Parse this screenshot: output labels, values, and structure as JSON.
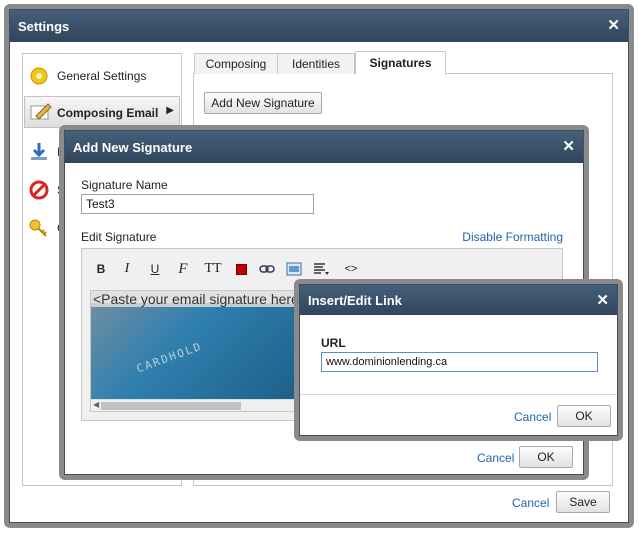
{
  "settings": {
    "title": "Settings",
    "sidebar": {
      "items": [
        {
          "label": "General Settings",
          "icon": "gear-icon"
        },
        {
          "label": "Composing Email",
          "icon": "compose-icon"
        },
        {
          "label": "Im",
          "icon": "import-icon"
        },
        {
          "label": "Sp",
          "icon": "spam-icon"
        },
        {
          "label": "Cl",
          "icon": "key-icon"
        }
      ]
    },
    "tabs": [
      {
        "label": "Composing"
      },
      {
        "label": "Identities"
      },
      {
        "label": "Signatures"
      }
    ],
    "add_signature_button": "Add New Signature",
    "cancel_label": "Cancel",
    "save_label": "Save"
  },
  "add_signature": {
    "title": "Add New Signature",
    "name_label": "Signature Name",
    "name_value": "Test3",
    "edit_label": "Edit Signature",
    "disable_formatting": "Disable Formatting",
    "editor_placeholder": "<Paste your email signature here>",
    "cancel_label": "Cancel",
    "ok_label": "OK",
    "toolbar": [
      {
        "label": "B",
        "icon": "bold-icon"
      },
      {
        "label": "I",
        "icon": "italic-icon"
      },
      {
        "label": "U",
        "icon": "underline-icon"
      },
      {
        "label": "F",
        "icon": "font-family-icon"
      },
      {
        "label": "TT",
        "icon": "font-size-icon"
      },
      {
        "label": "",
        "icon": "text-color-icon"
      },
      {
        "label": "",
        "icon": "link-icon"
      },
      {
        "label": "",
        "icon": "image-icon"
      },
      {
        "label": "",
        "icon": "align-icon"
      },
      {
        "label": "<>",
        "icon": "source-code-icon"
      }
    ],
    "accent_color": "#c00000"
  },
  "link_dialog": {
    "title": "Insert/Edit Link",
    "url_label": "URL",
    "url_value": "www.dominionlending.ca",
    "cancel_label": "Cancel",
    "ok_label": "OK"
  }
}
